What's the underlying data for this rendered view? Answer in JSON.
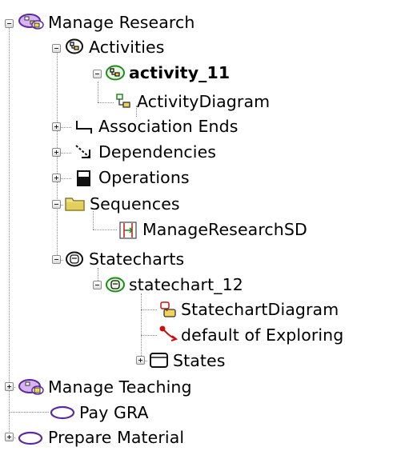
{
  "tree": {
    "nodes": {
      "manage_research": "Manage Research",
      "activities": "Activities",
      "activity_11": "activity_11",
      "activity_diagram": "ActivityDiagram",
      "association_ends": "Association Ends",
      "dependencies": "Dependencies",
      "operations": "Operations",
      "sequences": "Sequences",
      "manage_research_sd": "ManageResearchSD",
      "statecharts": "Statecharts",
      "statechart_12": "statechart_12",
      "statechart_diagram": "StatechartDiagram",
      "default_of_exploring": "default of Exploring",
      "states": "States",
      "manage_teaching": "Manage Teaching",
      "pay_gra": "Pay GRA",
      "prepare_material": "Prepare Material"
    },
    "icons": {
      "use_case_group": "use-case-group-icon",
      "activity": "activity-icon",
      "activity_diagram": "activity-diagram-icon",
      "association_end": "association-end-icon",
      "dependency": "dependency-icon",
      "operation": "operation-icon",
      "folder": "folder-icon",
      "sequence_diagram": "sequence-diagram-icon",
      "statechart": "statechart-icon",
      "statechart_diagram": "statechart-diagram-icon",
      "transition": "transition-icon",
      "state": "state-icon",
      "use_case": "use-case-icon"
    },
    "colors": {
      "activity_green": "#1f8a1f",
      "folder_yellow": "#e8d66a",
      "use_case_purple": "#5a2aa0",
      "transition_red": "#c81010"
    }
  }
}
